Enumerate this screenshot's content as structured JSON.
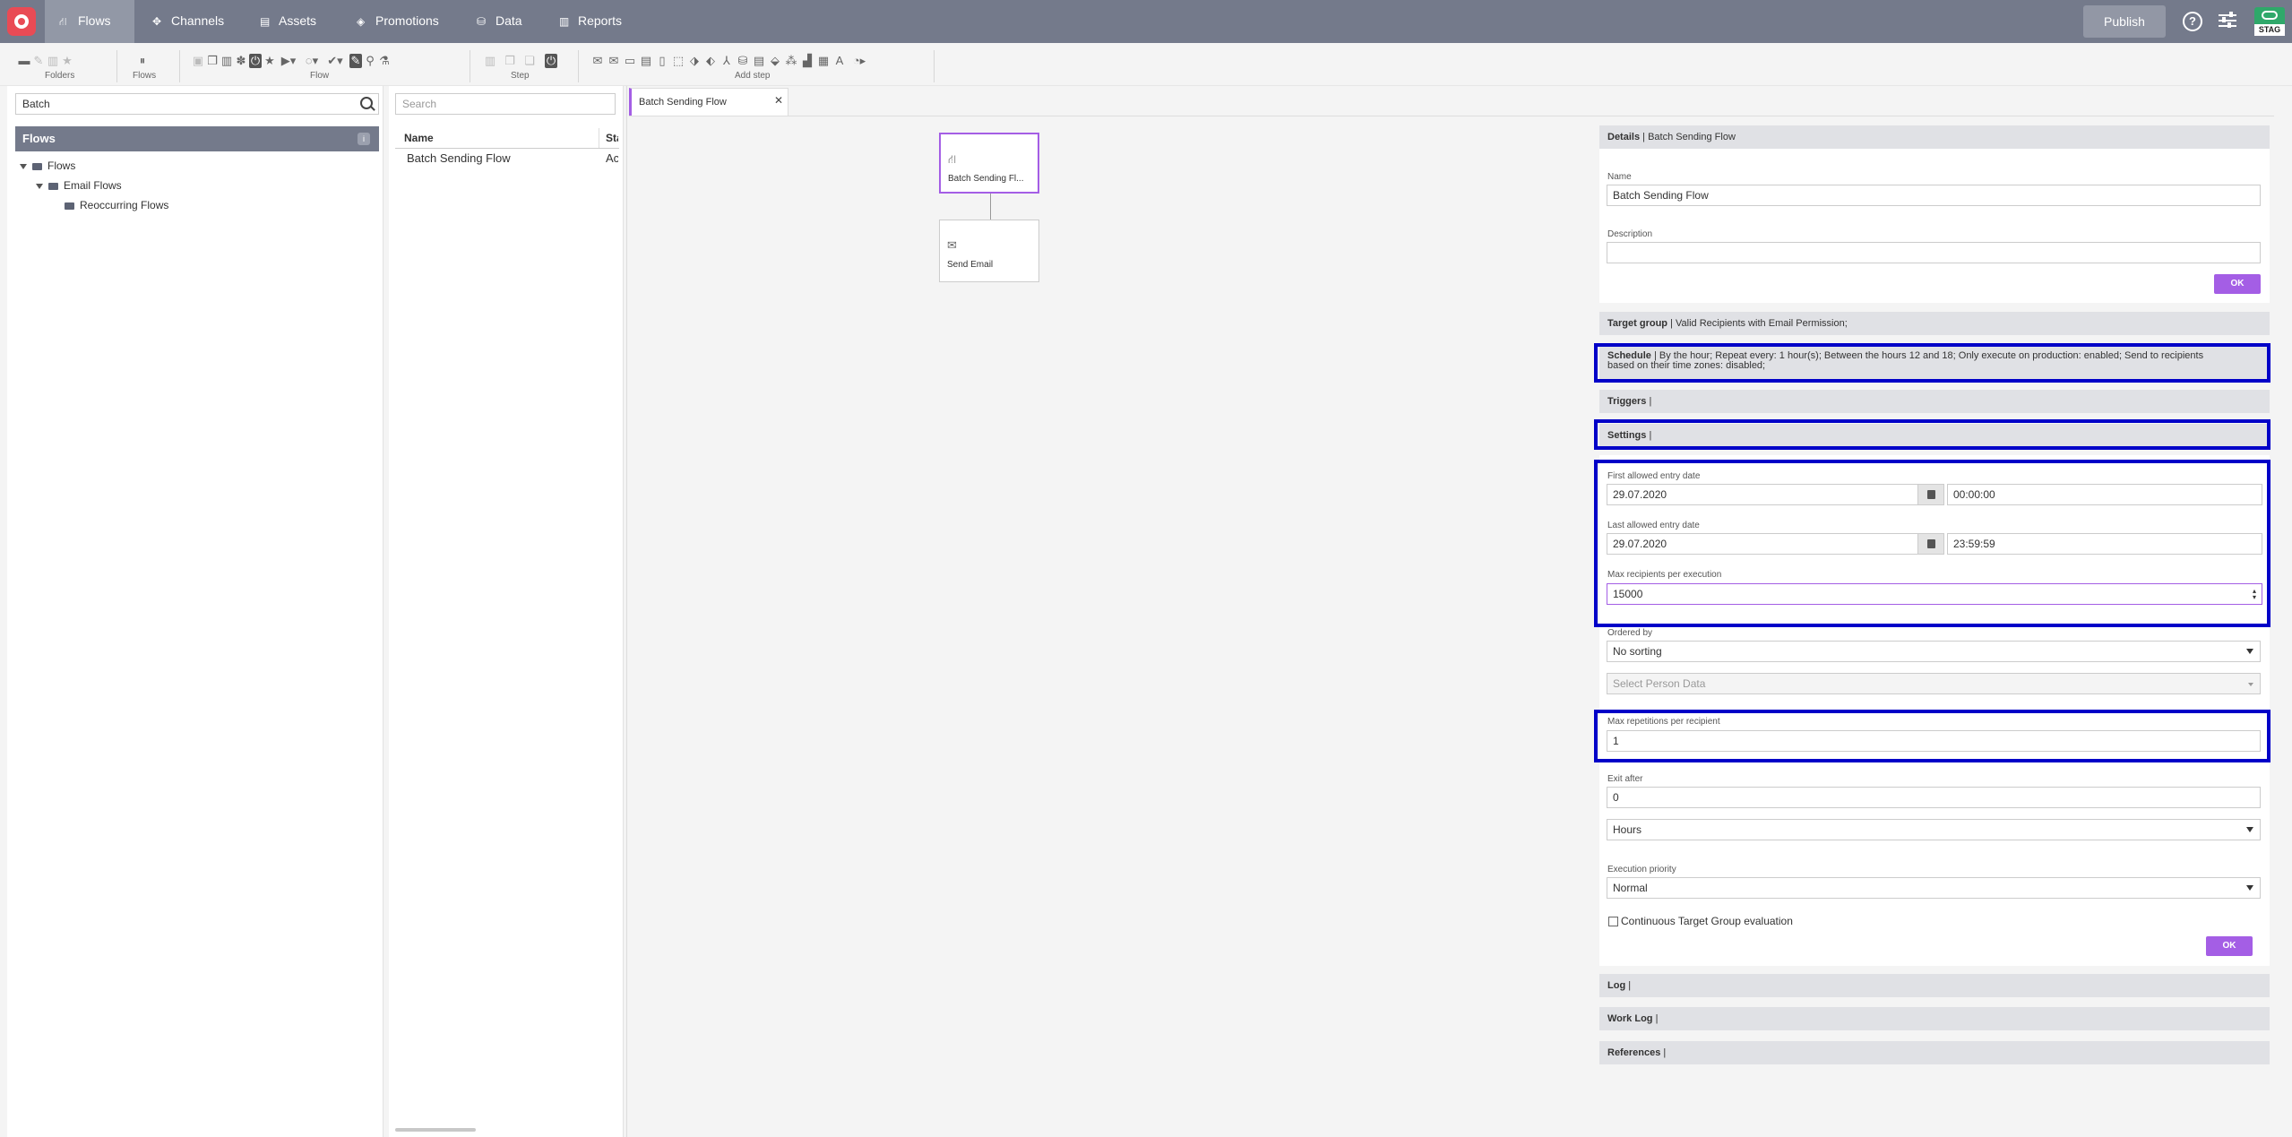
{
  "nav": {
    "items": [
      {
        "label": "Flows",
        "icon": "flow-icon"
      },
      {
        "label": "Channels",
        "icon": "channels-icon"
      },
      {
        "label": "Assets",
        "icon": "assets-icon"
      },
      {
        "label": "Promotions",
        "icon": "promotions-icon"
      },
      {
        "label": "Data",
        "icon": "data-icon"
      },
      {
        "label": "Reports",
        "icon": "reports-icon"
      }
    ],
    "publish_label": "Publish",
    "environment_badge": "STAG"
  },
  "toolbar": {
    "groups": [
      "Folders",
      "Flows",
      "Flow",
      "Step",
      "Add step"
    ]
  },
  "left_panel": {
    "search_value": "Batch",
    "header": "Flows",
    "info_badge": "i",
    "tree": [
      {
        "label": "Flows",
        "level": 0
      },
      {
        "label": "Email Flows",
        "level": 1
      },
      {
        "label": "Reoccurring Flows",
        "level": 2
      }
    ]
  },
  "list_panel": {
    "search_placeholder": "Search",
    "columns": [
      "Name",
      "Sta"
    ],
    "rows": [
      {
        "name": "Batch Sending Flow",
        "status": "Ac"
      }
    ]
  },
  "canvas": {
    "tab_title": "Batch Sending Flow",
    "nodes": [
      {
        "label": "Batch Sending Fl...",
        "icon": "flow-icon"
      },
      {
        "label": "Send Email",
        "icon": "email-icon"
      }
    ]
  },
  "details": {
    "header_title": "Details",
    "header_value": "Batch Sending Flow",
    "name_label": "Name",
    "name_value": "Batch Sending Flow",
    "description_label": "Description",
    "description_value": "",
    "ok_label": "OK"
  },
  "target_group": {
    "title": "Target group",
    "value": "Valid Recipients with Email Permission;"
  },
  "schedule": {
    "title": "Schedule",
    "value": "By the hour; Repeat every: 1 hour(s); Between the hours 12 and 18; Only execute on production: enabled; Send to recipients",
    "value2": "based on their time zones: disabled;"
  },
  "triggers": {
    "title": "Triggers",
    "value": ""
  },
  "settings": {
    "title": "Settings",
    "value": "",
    "first_entry_label": "First allowed entry date",
    "first_entry_date": "29.07.2020",
    "first_entry_time": "00:00:00",
    "last_entry_label": "Last allowed entry date",
    "last_entry_date": "29.07.2020",
    "last_entry_time": "23:59:59",
    "max_recipients_label": "Max recipients per execution",
    "max_recipients_value": "15000",
    "ordered_by_label": "Ordered by",
    "ordered_by_value": "No sorting",
    "person_data_placeholder": "Select Person Data",
    "max_repetitions_label": "Max repetitions per recipient",
    "max_repetitions_value": "1",
    "exit_after_label": "Exit after",
    "exit_after_value": "0",
    "exit_unit_value": "Hours",
    "priority_label": "Execution priority",
    "priority_value": "Normal",
    "continuous_label": "Continuous Target Group evaluation",
    "ok_label": "OK"
  },
  "log": {
    "title": "Log",
    "value": ""
  },
  "work_log": {
    "title": "Work Log",
    "value": ""
  },
  "references": {
    "title": "References",
    "value": ""
  },
  "colors": {
    "accent": "#a45ee5",
    "nav": "#747a8b",
    "highlight": "#0000c8"
  }
}
